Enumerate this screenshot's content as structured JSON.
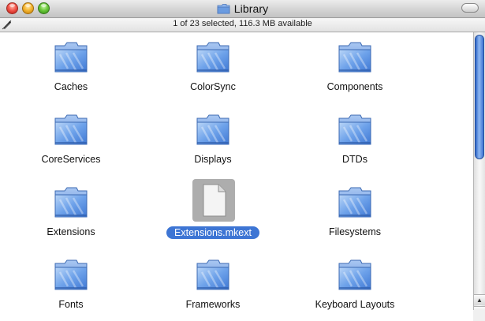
{
  "window": {
    "title": "Library",
    "status": "1 of 23 selected, 116.3 MB available"
  },
  "colors": {
    "selection": "#3d75d4",
    "folder_blue": "#6ea2ea",
    "scroll_thumb": "#3e74d2"
  },
  "items": [
    {
      "label": "Caches",
      "icon": "folder-icon",
      "selected": false
    },
    {
      "label": "ColorSync",
      "icon": "folder-icon",
      "selected": false
    },
    {
      "label": "Components",
      "icon": "folder-icon",
      "selected": false
    },
    {
      "label": "CoreServices",
      "icon": "folder-icon",
      "selected": false
    },
    {
      "label": "Displays",
      "icon": "folder-icon",
      "selected": false
    },
    {
      "label": "DTDs",
      "icon": "folder-icon",
      "selected": false
    },
    {
      "label": "Extensions",
      "icon": "folder-icon",
      "selected": false
    },
    {
      "label": "Extensions.mkext",
      "icon": "document-icon",
      "selected": true
    },
    {
      "label": "Filesystems",
      "icon": "folder-icon",
      "selected": false
    },
    {
      "label": "Fonts",
      "icon": "folder-icon",
      "selected": false
    },
    {
      "label": "Frameworks",
      "icon": "folder-icon",
      "selected": false
    },
    {
      "label": "Keyboard Layouts",
      "icon": "folder-icon",
      "selected": false
    }
  ]
}
